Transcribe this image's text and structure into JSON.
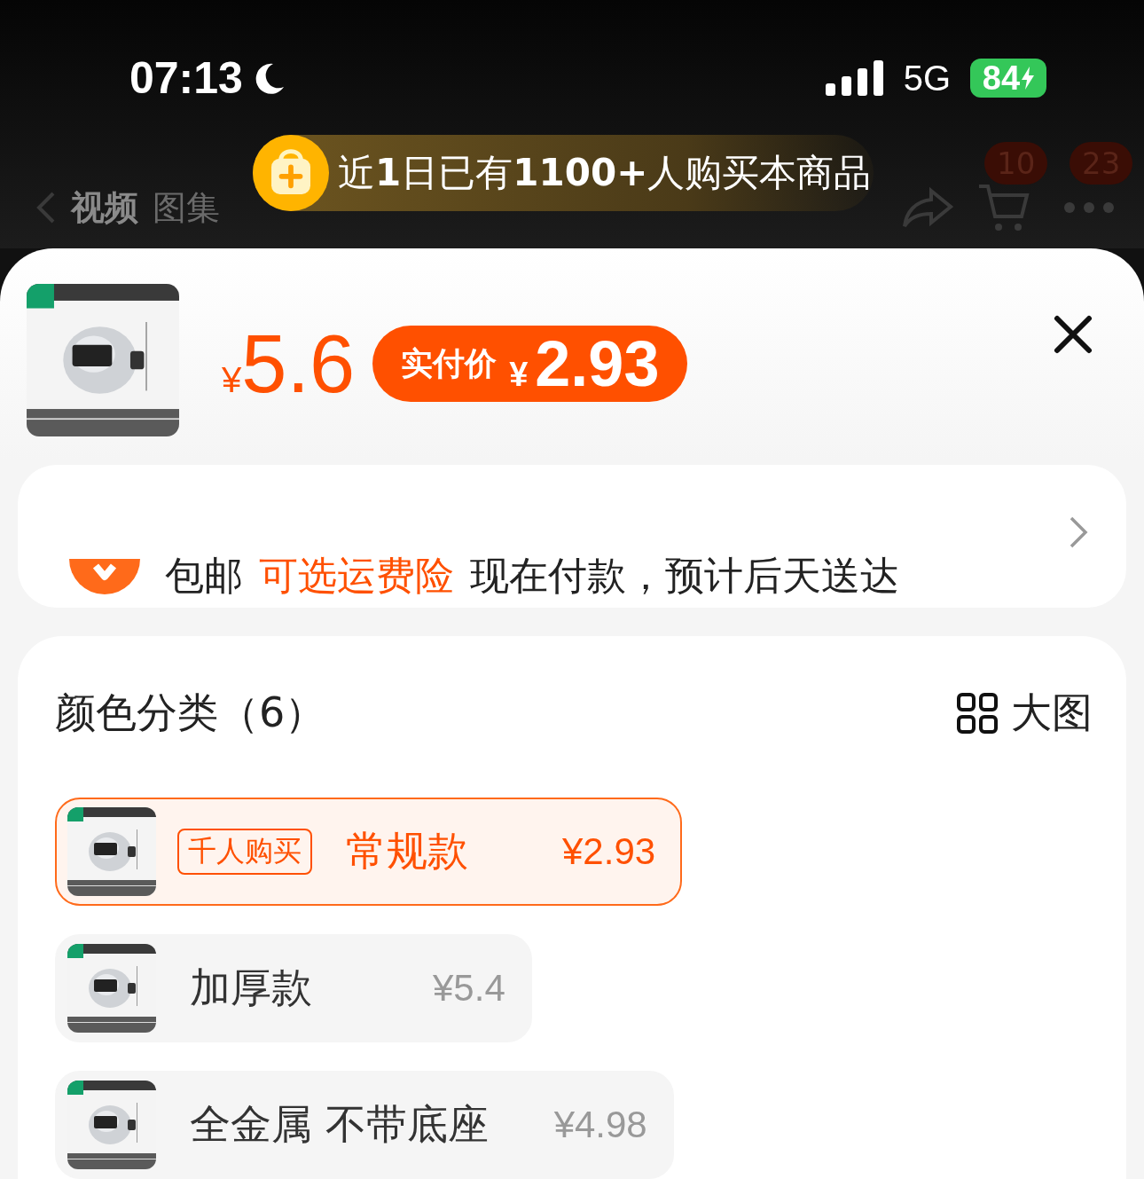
{
  "status_bar": {
    "time": "07:13",
    "network": "5G",
    "battery": "84",
    "charging": true
  },
  "banner": {
    "text": "近**1**日已有**1100+**人购买本商品"
  },
  "nav": {
    "tabs": [
      {
        "label": "视频",
        "selected": true
      },
      {
        "label": "图集",
        "selected": false
      }
    ],
    "cart_badge": "10",
    "more_badge": "23"
  },
  "product": {
    "price_symbol": "¥",
    "price": "5.6",
    "pay_label": "实付价",
    "pay_symbol": "¥",
    "pay_price": "2.93"
  },
  "delivery": {
    "free": "包邮",
    "insurance": "可选运费险",
    "eta": "现在付款，预计后天送达"
  },
  "variants": {
    "title": "颜色分类（6）",
    "view_toggle": "大图",
    "options": [
      {
        "badge": "千人购买",
        "name": "常规款",
        "price": "¥2.93",
        "selected": true
      },
      {
        "name": "加厚款",
        "price": "¥5.4",
        "selected": false
      },
      {
        "name": "全金属 不带底座",
        "price": "¥4.98",
        "selected": false
      }
    ]
  }
}
